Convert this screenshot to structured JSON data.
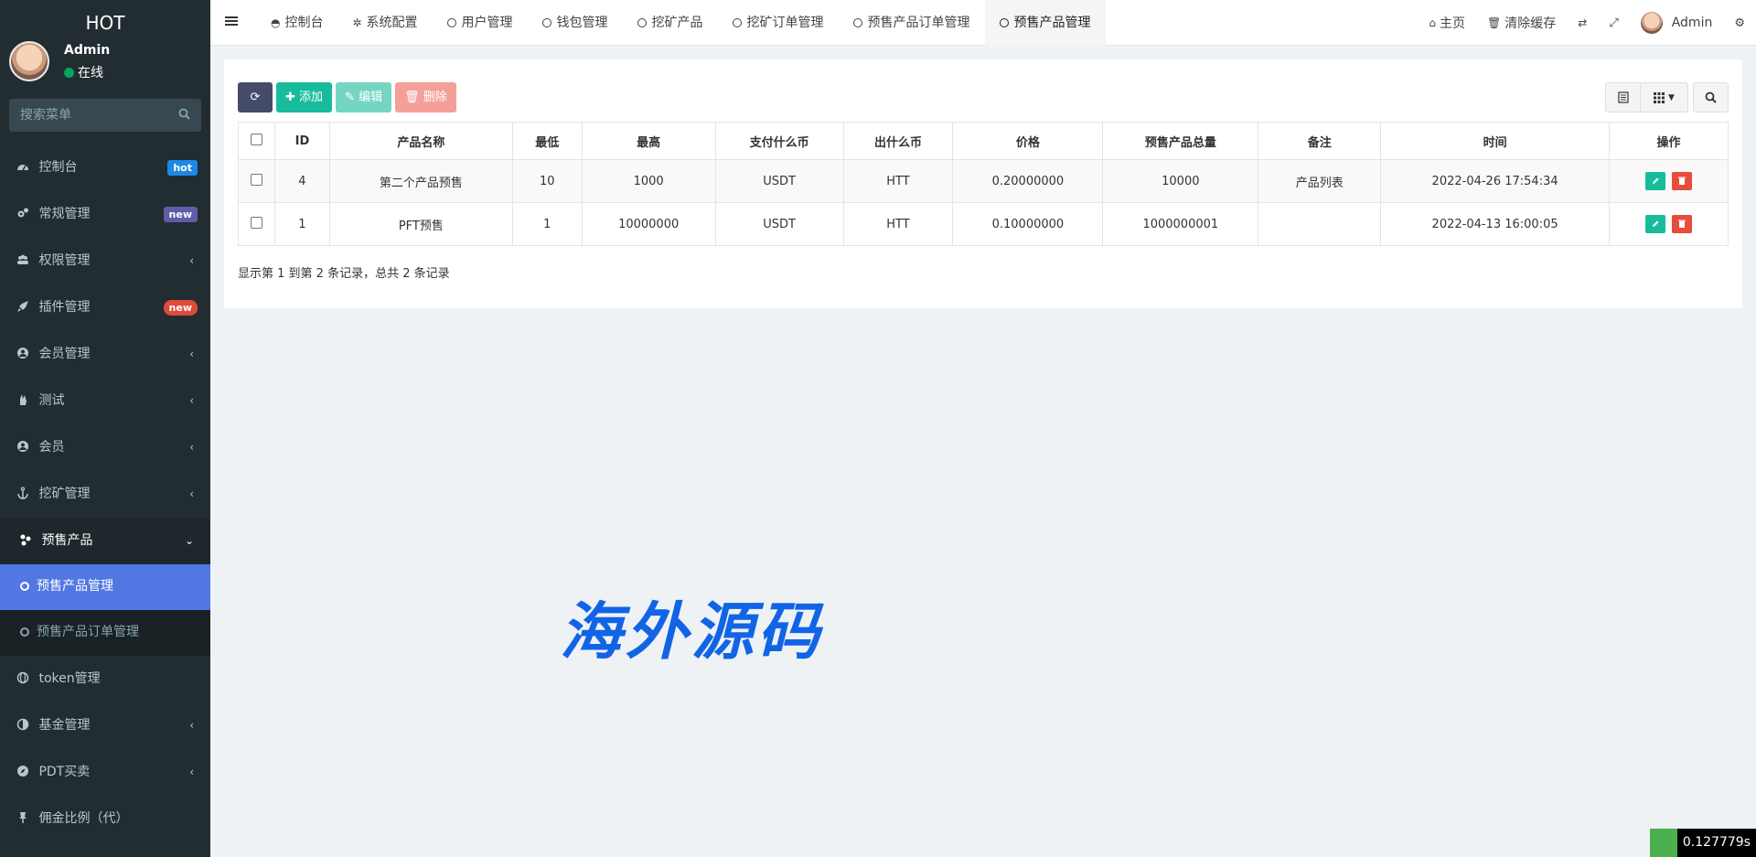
{
  "sidebar": {
    "logo": "HOT",
    "user": {
      "name": "Admin",
      "status": "在线"
    },
    "search_placeholder": "搜索菜单",
    "items": [
      {
        "label": "控制台",
        "icon": "dashboard-icon",
        "badge": "hot",
        "badge_color": "#1e88e5"
      },
      {
        "label": "常规管理",
        "icon": "cogs-icon",
        "badge": "new",
        "badge_color": "#605ca8"
      },
      {
        "label": "权限管理",
        "icon": "group-icon"
      },
      {
        "label": "插件管理",
        "icon": "rocket-icon",
        "badge": "new",
        "badge_color": "#dd4b39"
      },
      {
        "label": "会员管理",
        "icon": "user-circle-icon"
      },
      {
        "label": "测试",
        "icon": "hand-icon"
      },
      {
        "label": "会员",
        "icon": "user-circle-icon"
      },
      {
        "label": "挖矿管理",
        "icon": "anchor-icon"
      },
      {
        "label": "预售产品",
        "icon": "leaf-icon"
      }
    ],
    "submenu": [
      "预售产品管理",
      "预售产品订单管理"
    ],
    "items_after": [
      {
        "label": "token管理",
        "icon": "globe-icon"
      },
      {
        "label": "基金管理",
        "icon": "half-circle-icon"
      },
      {
        "label": "PDT买卖",
        "icon": "compass-icon"
      },
      {
        "label": "佣金比例（代）",
        "icon": "pushpin-icon"
      }
    ]
  },
  "topbar": {
    "tabs": [
      "控制台",
      "系统配置",
      "用户管理",
      "钱包管理",
      "挖矿产品",
      "挖矿订单管理",
      "预售产品订单管理",
      "预售产品管理"
    ],
    "right": {
      "home": "主页",
      "clear_cache": "清除缓存",
      "admin": "Admin"
    }
  },
  "toolbar": {
    "add": "添加",
    "edit": "编辑",
    "delete": "删除"
  },
  "table": {
    "columns": [
      "ID",
      "产品名称",
      "最低",
      "最高",
      "支付什么币",
      "出什么币",
      "价格",
      "预售产品总量",
      "备注",
      "时间",
      "操作"
    ],
    "rows": [
      [
        "4",
        "第二个产品预售",
        "10",
        "1000",
        "USDT",
        "HTT",
        "0.20000000",
        "10000",
        "产品列表",
        "2022-04-26 17:54:34"
      ],
      [
        "1",
        "PFT预售",
        "1",
        "10000000",
        "USDT",
        "HTT",
        "0.10000000",
        "1000000001",
        "",
        "2022-04-13 16:00:05"
      ]
    ]
  },
  "summary": "显示第 1 到第 2 条记录，总共 2 条记录",
  "watermark": "海外源码",
  "timer": "0.127779s"
}
